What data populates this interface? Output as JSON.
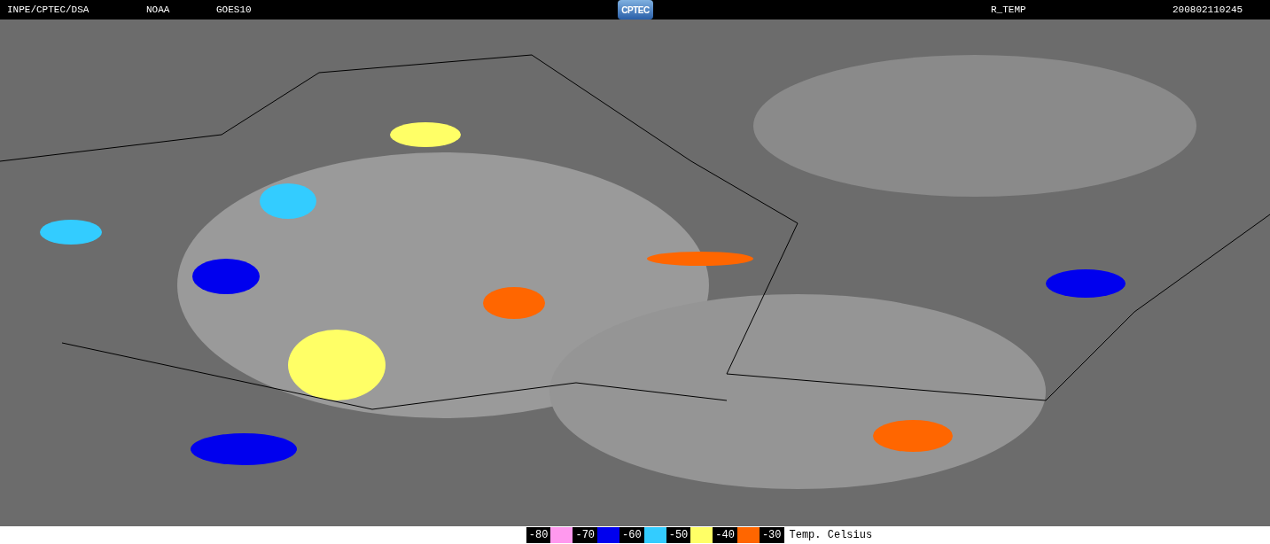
{
  "header": {
    "source": "INPE/CPTEC/DSA",
    "agency": "NOAA",
    "satellite": "GOES10",
    "logo": "CPTEC",
    "product": "R_TEMP",
    "timestamp": "200802110245"
  },
  "legend": {
    "items": [
      {
        "label": "-80",
        "color": "#ff99ee"
      },
      {
        "label": "-70",
        "color": "#0000ee"
      },
      {
        "label": "-60",
        "color": "#33ccff"
      },
      {
        "label": "-50",
        "color": "#ffff66"
      },
      {
        "label": "-40",
        "color": "#ff6600"
      },
      {
        "label": "-30"
      }
    ],
    "unit": "Temp. Celsius"
  }
}
